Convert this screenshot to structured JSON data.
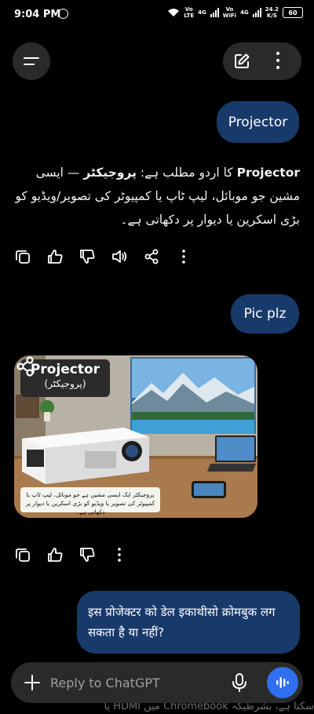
{
  "status_bar": {
    "time": "9:04 PM",
    "vo_lte": "Vo\nLTE",
    "vo_wifi": "Vo\nWiFi",
    "net1": "4G",
    "net2": "4G",
    "speed": "24.2\nK/S",
    "battery": "60"
  },
  "header": {
    "menu_icon": "hamburger-icon",
    "edit_icon": "edit-icon",
    "more_icon": "more-vertical-icon"
  },
  "messages": {
    "user1": "Projector",
    "assistant1": {
      "prefix": "کا اردو مطلب ہے: ",
      "urdu_bold": "پروجیکٹر",
      "line_rest": " — ایسی مشین جو موبائل، لیپ ٹاپ یا کمپیوٹر کی تصویر/ویڈیو کو بڑی اسکرین یا دیوار پر دکھاتی ہے۔",
      "english_bold": "Projector"
    },
    "user2": "Pic plz",
    "image": {
      "title": "Projector",
      "subtitle": "(پروجیکٹر)",
      "caption": "پروجیکٹر ایک ایسی مشین ہے جو موبائل، لیپ ٹاپ یا کمپیوٹر کی تصویر یا ویڈیو کو بڑی اسکرین یا دیوار پر دکھاتی ہے۔"
    },
    "user3": "इस प्रोजेक्टर को डेल इकाथीसो क्रोमबुक लग सकता है या नहीं?"
  },
  "actions": [
    "copy-icon",
    "thumbs-up-icon",
    "thumbs-down-icon",
    "speaker-icon",
    "share-icon",
    "more-icon"
  ],
  "composer": {
    "placeholder": "Reply to ChatGPT"
  },
  "behind_text": "سکتا ہے، بشرطیکہ Chromebook میں HDMI یا"
}
